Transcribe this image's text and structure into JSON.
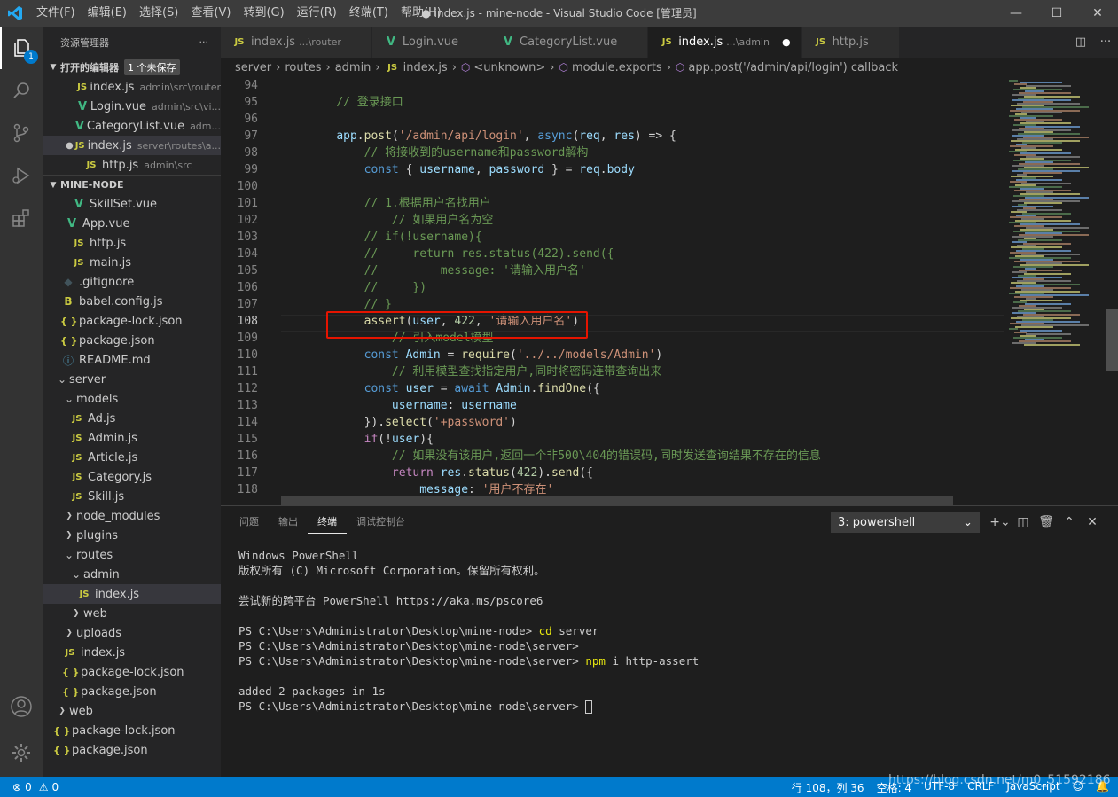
{
  "window": {
    "title": "● index.js - mine-node - Visual Studio Code [管理员]",
    "menu": [
      "文件(F)",
      "编辑(E)",
      "选择(S)",
      "查看(V)",
      "转到(G)",
      "运行(R)",
      "终端(T)",
      "帮助(H)"
    ]
  },
  "activity": {
    "badge": "1"
  },
  "sidebar": {
    "title": "资源管理器",
    "open_editors_label": "打开的编辑器",
    "unsaved_label": "1 个未保存",
    "open_editors": [
      {
        "name": "index.js",
        "path": "admin\\src\\router",
        "type": "js",
        "dot": false
      },
      {
        "name": "Login.vue",
        "path": "admin\\src\\vi...",
        "type": "vue",
        "dot": false
      },
      {
        "name": "CategoryList.vue",
        "path": "adm...",
        "type": "vue",
        "dot": false
      },
      {
        "name": "index.js",
        "path": "server\\routes\\a...",
        "type": "js",
        "dot": true
      },
      {
        "name": "http.js",
        "path": "admin\\src",
        "type": "js",
        "dot": false
      }
    ],
    "project_label": "MINE-NODE",
    "tree": [
      {
        "name": "SkillSet.vue",
        "type": "vue",
        "indent": 32
      },
      {
        "name": "App.vue",
        "type": "vue",
        "indent": 24
      },
      {
        "name": "http.js",
        "type": "js",
        "indent": 32
      },
      {
        "name": "main.js",
        "type": "js",
        "indent": 32
      },
      {
        "name": ".gitignore",
        "type": "git",
        "indent": 20
      },
      {
        "name": "babel.config.js",
        "type": "babel",
        "indent": 20
      },
      {
        "name": "package-lock.json",
        "type": "json",
        "indent": 20
      },
      {
        "name": "package.json",
        "type": "json",
        "indent": 20
      },
      {
        "name": "README.md",
        "type": "info",
        "indent": 20
      },
      {
        "name": "server",
        "type": "folder-open",
        "indent": 14
      },
      {
        "name": "models",
        "type": "folder-open",
        "indent": 22
      },
      {
        "name": "Ad.js",
        "type": "js",
        "indent": 30
      },
      {
        "name": "Admin.js",
        "type": "js",
        "indent": 30
      },
      {
        "name": "Article.js",
        "type": "js",
        "indent": 30
      },
      {
        "name": "Category.js",
        "type": "js",
        "indent": 30
      },
      {
        "name": "Skill.js",
        "type": "js",
        "indent": 30
      },
      {
        "name": "node_modules",
        "type": "folder",
        "indent": 22
      },
      {
        "name": "plugins",
        "type": "folder",
        "indent": 22
      },
      {
        "name": "routes",
        "type": "folder-open",
        "indent": 22
      },
      {
        "name": "admin",
        "type": "folder-open",
        "indent": 30
      },
      {
        "name": "index.js",
        "type": "js",
        "indent": 38,
        "selected": true
      },
      {
        "name": "web",
        "type": "folder",
        "indent": 30
      },
      {
        "name": "uploads",
        "type": "folder",
        "indent": 22
      },
      {
        "name": "index.js",
        "type": "js",
        "indent": 22
      },
      {
        "name": "package-lock.json",
        "type": "json",
        "indent": 22
      },
      {
        "name": "package.json",
        "type": "json",
        "indent": 22
      },
      {
        "name": "web",
        "type": "folder",
        "indent": 14
      },
      {
        "name": "package-lock.json",
        "type": "json",
        "indent": 12
      },
      {
        "name": "package.json",
        "type": "json",
        "indent": 12
      }
    ]
  },
  "tabs": [
    {
      "name": "index.js",
      "path": "...\\router",
      "type": "js",
      "active": false
    },
    {
      "name": "Login.vue",
      "path": "",
      "type": "vue",
      "active": false
    },
    {
      "name": "CategoryList.vue",
      "path": "",
      "type": "vue",
      "active": false
    },
    {
      "name": "index.js",
      "path": "...\\admin",
      "type": "js",
      "active": true,
      "dirty": true
    },
    {
      "name": "http.js",
      "path": "",
      "type": "js",
      "active": false
    }
  ],
  "breadcrumbs": [
    "server",
    "routes",
    "admin",
    "index.js",
    "<unknown>",
    "module.exports",
    "app.post('/admin/api/login') callback"
  ],
  "editor": {
    "current_line": 108,
    "lines": [
      {
        "n": 94,
        "t": ""
      },
      {
        "n": 95,
        "t": "    // 登录接口"
      },
      {
        "n": 96,
        "t": ""
      },
      {
        "n": 97,
        "t": "    app.post('/admin/api/login', async(req, res) => {"
      },
      {
        "n": 98,
        "t": "        // 将接收到的username和password解构"
      },
      {
        "n": 99,
        "t": "        const { username, password } = req.body"
      },
      {
        "n": 100,
        "t": ""
      },
      {
        "n": 101,
        "t": "        // 1.根据用户名找用户"
      },
      {
        "n": 102,
        "t": "            // 如果用户名为空"
      },
      {
        "n": 103,
        "t": "        // if(!username){"
      },
      {
        "n": 104,
        "t": "        //     return res.status(422).send({"
      },
      {
        "n": 105,
        "t": "        //         message: '请输入用户名'"
      },
      {
        "n": 106,
        "t": "        //     })"
      },
      {
        "n": 107,
        "t": "        // }"
      },
      {
        "n": 108,
        "t": "        assert(user, 422, '请输入用户名')"
      },
      {
        "n": 109,
        "t": "            // 引入model模型"
      },
      {
        "n": 110,
        "t": "        const Admin = require('../../models/Admin')"
      },
      {
        "n": 111,
        "t": "            // 利用模型查找指定用户,同时将密码连带查询出来"
      },
      {
        "n": 112,
        "t": "        const user = await Admin.findOne({"
      },
      {
        "n": 113,
        "t": "            username: username"
      },
      {
        "n": 114,
        "t": "        }).select('+password')"
      },
      {
        "n": 115,
        "t": "        if(!user){"
      },
      {
        "n": 116,
        "t": "            // 如果没有该用户,返回一个非500\\404的错误码,同时发送查询结果不存在的信息"
      },
      {
        "n": 117,
        "t": "            return res.status(422).send({"
      },
      {
        "n": 118,
        "t": "                message: '用户不存在'"
      }
    ]
  },
  "panel": {
    "tabs": [
      "问题",
      "输出",
      "终端",
      "调试控制台"
    ],
    "active_tab": "终端",
    "terminal_select": "3: powershell",
    "terminal_lines": [
      "Windows PowerShell",
      "版权所有 (C) Microsoft Corporation。保留所有权利。",
      "",
      "尝试新的跨平台 PowerShell https://aka.ms/pscore6",
      "",
      "PS C:\\Users\\Administrator\\Desktop\\mine-node> cd server",
      "PS C:\\Users\\Administrator\\Desktop\\mine-node\\server>",
      "PS C:\\Users\\Administrator\\Desktop\\mine-node\\server> npm i http-assert",
      "",
      "added 2 packages in 1s",
      "PS C:\\Users\\Administrator\\Desktop\\mine-node\\server> "
    ]
  },
  "status": {
    "errors": "0",
    "warnings": "0",
    "position": "行 108，列 36",
    "spaces": "空格: 4",
    "encoding": "UTF-8",
    "eol": "CRLF",
    "language": "JavaScript"
  },
  "watermark": "https://blog.csdn.net/m0_51592186",
  "colors": {
    "accent": "#007acc",
    "highlight_box": "#e51400"
  }
}
